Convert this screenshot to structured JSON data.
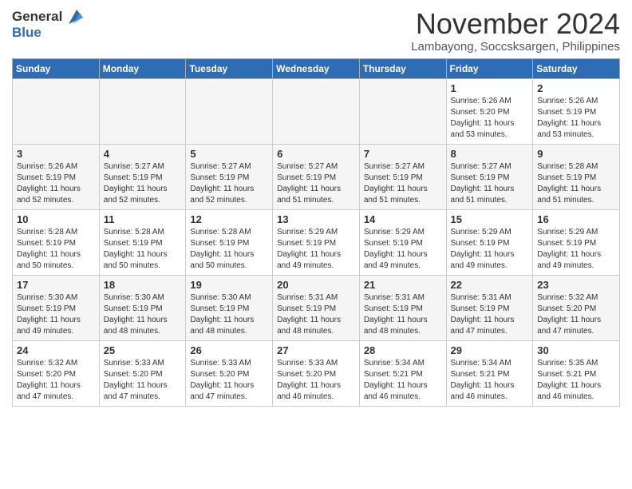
{
  "header": {
    "logo_line1": "General",
    "logo_line2": "Blue",
    "month_title": "November 2024",
    "location": "Lambayong, Soccsksargen, Philippines"
  },
  "weekdays": [
    "Sunday",
    "Monday",
    "Tuesday",
    "Wednesday",
    "Thursday",
    "Friday",
    "Saturday"
  ],
  "weeks": [
    [
      {
        "day": "",
        "info": "",
        "empty": true
      },
      {
        "day": "",
        "info": "",
        "empty": true
      },
      {
        "day": "",
        "info": "",
        "empty": true
      },
      {
        "day": "",
        "info": "",
        "empty": true
      },
      {
        "day": "",
        "info": "",
        "empty": true
      },
      {
        "day": "1",
        "info": "Sunrise: 5:26 AM\nSunset: 5:20 PM\nDaylight: 11 hours\nand 53 minutes."
      },
      {
        "day": "2",
        "info": "Sunrise: 5:26 AM\nSunset: 5:19 PM\nDaylight: 11 hours\nand 53 minutes."
      }
    ],
    [
      {
        "day": "3",
        "info": "Sunrise: 5:26 AM\nSunset: 5:19 PM\nDaylight: 11 hours\nand 52 minutes."
      },
      {
        "day": "4",
        "info": "Sunrise: 5:27 AM\nSunset: 5:19 PM\nDaylight: 11 hours\nand 52 minutes."
      },
      {
        "day": "5",
        "info": "Sunrise: 5:27 AM\nSunset: 5:19 PM\nDaylight: 11 hours\nand 52 minutes."
      },
      {
        "day": "6",
        "info": "Sunrise: 5:27 AM\nSunset: 5:19 PM\nDaylight: 11 hours\nand 51 minutes."
      },
      {
        "day": "7",
        "info": "Sunrise: 5:27 AM\nSunset: 5:19 PM\nDaylight: 11 hours\nand 51 minutes."
      },
      {
        "day": "8",
        "info": "Sunrise: 5:27 AM\nSunset: 5:19 PM\nDaylight: 11 hours\nand 51 minutes."
      },
      {
        "day": "9",
        "info": "Sunrise: 5:28 AM\nSunset: 5:19 PM\nDaylight: 11 hours\nand 51 minutes."
      }
    ],
    [
      {
        "day": "10",
        "info": "Sunrise: 5:28 AM\nSunset: 5:19 PM\nDaylight: 11 hours\nand 50 minutes."
      },
      {
        "day": "11",
        "info": "Sunrise: 5:28 AM\nSunset: 5:19 PM\nDaylight: 11 hours\nand 50 minutes."
      },
      {
        "day": "12",
        "info": "Sunrise: 5:28 AM\nSunset: 5:19 PM\nDaylight: 11 hours\nand 50 minutes."
      },
      {
        "day": "13",
        "info": "Sunrise: 5:29 AM\nSunset: 5:19 PM\nDaylight: 11 hours\nand 49 minutes."
      },
      {
        "day": "14",
        "info": "Sunrise: 5:29 AM\nSunset: 5:19 PM\nDaylight: 11 hours\nand 49 minutes."
      },
      {
        "day": "15",
        "info": "Sunrise: 5:29 AM\nSunset: 5:19 PM\nDaylight: 11 hours\nand 49 minutes."
      },
      {
        "day": "16",
        "info": "Sunrise: 5:29 AM\nSunset: 5:19 PM\nDaylight: 11 hours\nand 49 minutes."
      }
    ],
    [
      {
        "day": "17",
        "info": "Sunrise: 5:30 AM\nSunset: 5:19 PM\nDaylight: 11 hours\nand 49 minutes."
      },
      {
        "day": "18",
        "info": "Sunrise: 5:30 AM\nSunset: 5:19 PM\nDaylight: 11 hours\nand 48 minutes."
      },
      {
        "day": "19",
        "info": "Sunrise: 5:30 AM\nSunset: 5:19 PM\nDaylight: 11 hours\nand 48 minutes."
      },
      {
        "day": "20",
        "info": "Sunrise: 5:31 AM\nSunset: 5:19 PM\nDaylight: 11 hours\nand 48 minutes."
      },
      {
        "day": "21",
        "info": "Sunrise: 5:31 AM\nSunset: 5:19 PM\nDaylight: 11 hours\nand 48 minutes."
      },
      {
        "day": "22",
        "info": "Sunrise: 5:31 AM\nSunset: 5:19 PM\nDaylight: 11 hours\nand 47 minutes."
      },
      {
        "day": "23",
        "info": "Sunrise: 5:32 AM\nSunset: 5:20 PM\nDaylight: 11 hours\nand 47 minutes."
      }
    ],
    [
      {
        "day": "24",
        "info": "Sunrise: 5:32 AM\nSunset: 5:20 PM\nDaylight: 11 hours\nand 47 minutes."
      },
      {
        "day": "25",
        "info": "Sunrise: 5:33 AM\nSunset: 5:20 PM\nDaylight: 11 hours\nand 47 minutes."
      },
      {
        "day": "26",
        "info": "Sunrise: 5:33 AM\nSunset: 5:20 PM\nDaylight: 11 hours\nand 47 minutes."
      },
      {
        "day": "27",
        "info": "Sunrise: 5:33 AM\nSunset: 5:20 PM\nDaylight: 11 hours\nand 46 minutes."
      },
      {
        "day": "28",
        "info": "Sunrise: 5:34 AM\nSunset: 5:21 PM\nDaylight: 11 hours\nand 46 minutes."
      },
      {
        "day": "29",
        "info": "Sunrise: 5:34 AM\nSunset: 5:21 PM\nDaylight: 11 hours\nand 46 minutes."
      },
      {
        "day": "30",
        "info": "Sunrise: 5:35 AM\nSunset: 5:21 PM\nDaylight: 11 hours\nand 46 minutes."
      }
    ]
  ]
}
